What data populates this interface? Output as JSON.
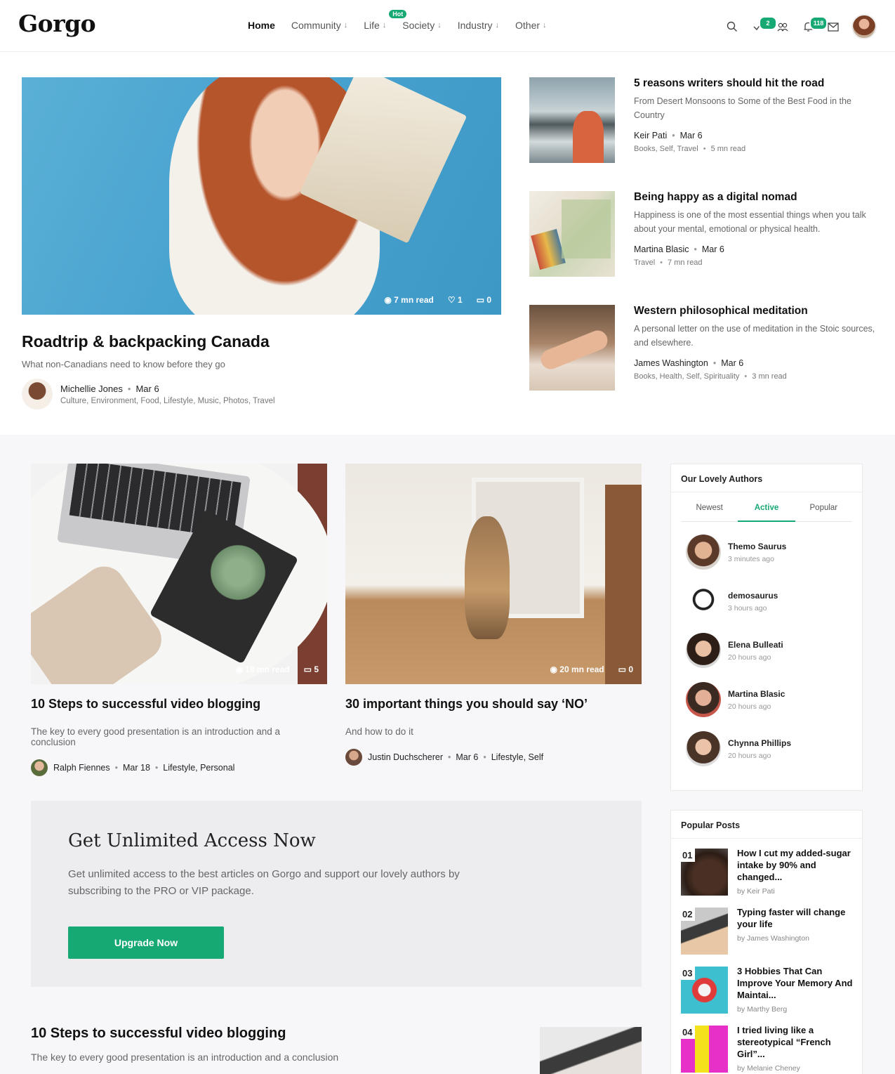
{
  "site": {
    "logo": "Gorgo"
  },
  "nav": {
    "items": [
      {
        "label": "Home",
        "arrow": ""
      },
      {
        "label": "Community",
        "arrow": "↓"
      },
      {
        "label": "Life",
        "arrow": "↓",
        "badge": "Hot"
      },
      {
        "label": "Society",
        "arrow": "↓"
      },
      {
        "label": "Industry",
        "arrow": "↓"
      },
      {
        "label": "Other",
        "arrow": "↓"
      }
    ]
  },
  "header_icons": {
    "tasks_count": "2",
    "notifications_count": "118"
  },
  "hero": {
    "views": "7 mn read",
    "likes": "1",
    "comments": "0",
    "title": "Roadtrip & backpacking Canada",
    "subtitle": "What non-Canadians need to know before they go",
    "author": "Michellie Jones",
    "date": "Mar 6",
    "tags": "Culture, Environment, Food, Lifestyle, Music, Photos, Travel"
  },
  "side_posts": [
    {
      "title": "5 reasons writers should hit the road",
      "desc": "From Desert Monsoons to Some of the Best Food in the Country",
      "author": "Keir Pati",
      "date": "Mar 6",
      "tags": "Books, Self, Travel",
      "read": "5 mn read"
    },
    {
      "title": "Being happy as a digital nomad",
      "desc": "Happiness is one of the most essential things when you talk about your mental, emotional or physical health.",
      "author": "Martina Blasic",
      "date": "Mar 6",
      "tags": "Travel",
      "read": "7 mn read"
    },
    {
      "title": "Western philosophical meditation",
      "desc": "A personal letter on the use of meditation in the Stoic sources, and elsewhere.",
      "author": "James Washington",
      "date": "Mar 6",
      "tags": "Books, Health, Self, Spirituality",
      "read": "3 mn read"
    }
  ],
  "cards": [
    {
      "read": "18 mn read",
      "comments": "5",
      "title": "10 Steps to successful video blogging",
      "desc": "The key to every good presentation is an introduction and a conclusion",
      "author": "Ralph Fiennes",
      "date": "Mar 18",
      "tags": "Lifestyle, Personal"
    },
    {
      "read": "20 mn read",
      "comments": "0",
      "title": "30 important things you should say ‘NO’",
      "desc": "And how to do it",
      "author": "Justin Duchscherer",
      "date": "Mar 6",
      "tags": "Lifestyle, Self"
    }
  ],
  "cta": {
    "title": "Get Unlimited Access Now",
    "desc": "Get unlimited access to the best articles on Gorgo and support our lovely authors by subscribing to the PRO or VIP package.",
    "button": "Upgrade Now"
  },
  "bottom_post": {
    "title": "10 Steps to successful video blogging",
    "desc": "The key to every good presentation is an introduction and a conclusion"
  },
  "authors_widget": {
    "title": "Our Lovely Authors",
    "tabs": [
      "Newest",
      "Active",
      "Popular"
    ],
    "active_tab": "Active",
    "authors": [
      {
        "name": "Themo Saurus",
        "time": "3 minutes ago"
      },
      {
        "name": "demosaurus",
        "time": "3 hours ago"
      },
      {
        "name": "Elena Bulleati",
        "time": "20 hours ago"
      },
      {
        "name": "Martina Blasic",
        "time": "20 hours ago"
      },
      {
        "name": "Chynna Phillips",
        "time": "20 hours ago"
      }
    ]
  },
  "popular_widget": {
    "title": "Popular Posts",
    "posts": [
      {
        "num": "01",
        "title": "How I cut my added-sugar intake by 90% and changed...",
        "by": "by Keir Pati"
      },
      {
        "num": "02",
        "title": "Typing faster will change your life",
        "by": "by James Washington"
      },
      {
        "num": "03",
        "title": "3 Hobbies That Can Improve Your Memory And Maintai...",
        "by": "by Marthy Berg"
      },
      {
        "num": "04",
        "title": "I tried living like a stereotypical “French Girl”...",
        "by": "by Melanie Cheney"
      }
    ]
  },
  "colors": {
    "accent": "#17a974",
    "section_bg": "#f7f7f9",
    "cta_bg": "#ededf0"
  }
}
